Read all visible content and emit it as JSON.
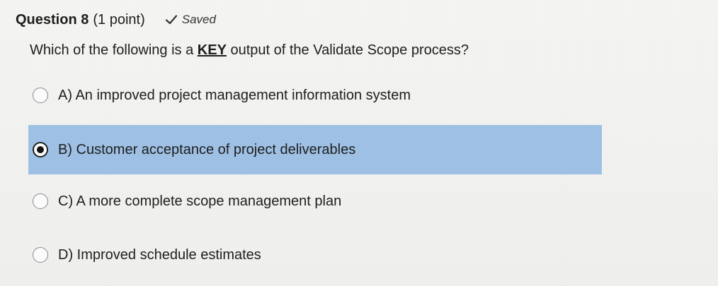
{
  "question": {
    "title": "Question 8",
    "points": "(1 point)",
    "status": "Saved",
    "status_icon": "check-icon",
    "prompt_before": "Which of the following is a ",
    "prompt_key": "KEY",
    "prompt_after": " output of the Validate Scope process?"
  },
  "options": [
    {
      "label": "A) An improved project management information system",
      "selected": false
    },
    {
      "label": "B) Customer acceptance of project deliverables",
      "selected": true
    },
    {
      "label": "C) A more complete scope management plan",
      "selected": false
    },
    {
      "label": "D) Improved schedule estimates",
      "selected": false
    }
  ],
  "colors": {
    "selected_background": "#9ec0e4",
    "page_background": "#f2f2f0"
  }
}
